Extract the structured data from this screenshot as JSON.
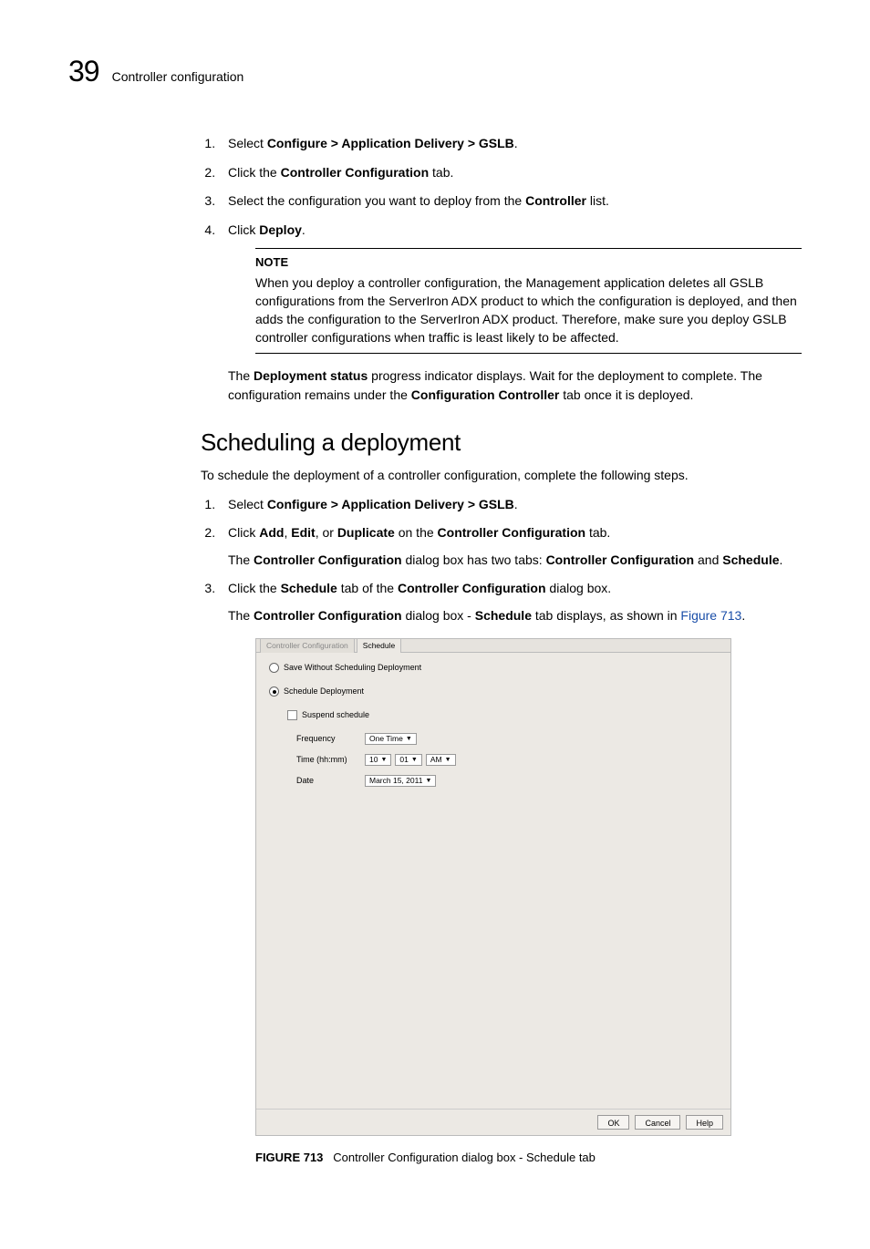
{
  "header": {
    "page_number": "39",
    "section_label": "Controller configuration"
  },
  "steps_a": {
    "s1_pre": "Select ",
    "s1_bold": "Configure > Application Delivery > GSLB",
    "s1_post": ".",
    "s2_pre": "Click the ",
    "s2_bold": "Controller Configuration",
    "s2_post": " tab.",
    "s3_pre": "Select the configuration you want to deploy from the ",
    "s3_bold": "Controller",
    "s3_post": " list.",
    "s4_pre": "Click ",
    "s4_bold": "Deploy",
    "s4_post": "."
  },
  "note": {
    "title": "NOTE",
    "body": "When you deploy a controller configuration, the Management application deletes all GSLB configurations from the ServerIron ADX product to which the configuration is deployed, and then adds the configuration to the ServerIron ADX product. Therefore, make sure you deploy GSLB controller configurations when traffic is least likely to be affected."
  },
  "after_note": {
    "pre": "The ",
    "bold1": "Deployment status",
    "mid": " progress indicator displays. Wait for the deployment to complete. The configuration remains under the ",
    "bold2": "Configuration Controller",
    "post": " tab once it is deployed."
  },
  "heading": "Scheduling a deployment",
  "intro": "To schedule the deployment of a controller configuration, complete the following steps.",
  "steps_b": {
    "s1_pre": "Select ",
    "s1_bold": "Configure > Application Delivery > GSLB",
    "s1_post": ".",
    "s2_pre": "Click ",
    "s2_b1": "Add",
    "s2_m1": ", ",
    "s2_b2": "Edit",
    "s2_m2": ", or ",
    "s2_b3": "Duplicate",
    "s2_m3": " on the ",
    "s2_b4": "Controller Configuration",
    "s2_post": " tab.",
    "s2_sub_pre": "The ",
    "s2_sub_b1": "Controller Configuration",
    "s2_sub_m1": " dialog box has two tabs: ",
    "s2_sub_b2": "Controller Configuration",
    "s2_sub_m2": " and ",
    "s2_sub_b3": "Schedule",
    "s2_sub_post": ".",
    "s3_pre": "Click the ",
    "s3_b1": "Schedule",
    "s3_m1": " tab of the ",
    "s3_b2": "Controller Configuration",
    "s3_post": " dialog box.",
    "s3_sub_pre": "The ",
    "s3_sub_b1": "Controller Configuration",
    "s3_sub_m1": " dialog box - ",
    "s3_sub_b2": "Schedule",
    "s3_sub_m2": " tab displays, as shown in ",
    "s3_sub_link": "Figure 713",
    "s3_sub_post": "."
  },
  "dialog": {
    "tab_inactive": "Controller Configuration",
    "tab_active": "Schedule",
    "radio_save": "Save Without Scheduling Deployment",
    "radio_sched": "Schedule Deployment",
    "check_suspend": "Suspend schedule",
    "field_frequency_label": "Frequency",
    "field_frequency_value": "One Time",
    "field_time_label": "Time (hh:mm)",
    "field_time_hh": "10",
    "field_time_mm": "01",
    "field_time_ampm": "AM",
    "field_date_label": "Date",
    "field_date_value": "March 15, 2011",
    "btn_ok": "OK",
    "btn_cancel": "Cancel",
    "btn_help": "Help"
  },
  "figure": {
    "caption_head": "FIGURE 713",
    "caption_body": "Controller Configuration dialog box - Schedule tab"
  }
}
